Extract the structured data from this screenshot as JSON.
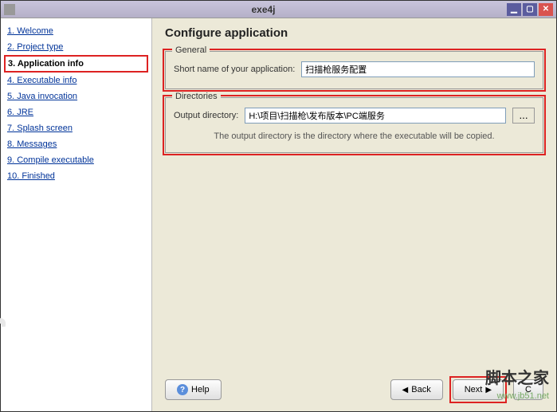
{
  "window": {
    "title": "exe4j"
  },
  "sidebar": {
    "steps": [
      {
        "label": "1. Welcome"
      },
      {
        "label": "2. Project type"
      },
      {
        "label": "3. Application info"
      },
      {
        "label": "4. Executable info"
      },
      {
        "label": "5. Java invocation"
      },
      {
        "label": "6. JRE"
      },
      {
        "label": "7. Splash screen"
      },
      {
        "label": "8. Messages"
      },
      {
        "label": "9. Compile executable"
      },
      {
        "label": "10. Finished"
      }
    ],
    "current_index": 2,
    "logo": "exe4j"
  },
  "page": {
    "title": "Configure application",
    "general": {
      "legend": "General",
      "short_name_label": "Short name of your application:",
      "short_name_value": "扫描枪服务配置"
    },
    "directories": {
      "legend": "Directories",
      "output_label": "Output directory:",
      "output_value": "H:\\项目\\扫描枪\\发布版本\\PC端服务",
      "browse_label": "...",
      "hint": "The output directory is the directory where the executable will be copied."
    }
  },
  "footer": {
    "help": "Help",
    "back": "Back",
    "next": "Next",
    "cancel": "C"
  },
  "watermark": {
    "line1": "脚本之家",
    "line2": "www.jb51.net"
  }
}
